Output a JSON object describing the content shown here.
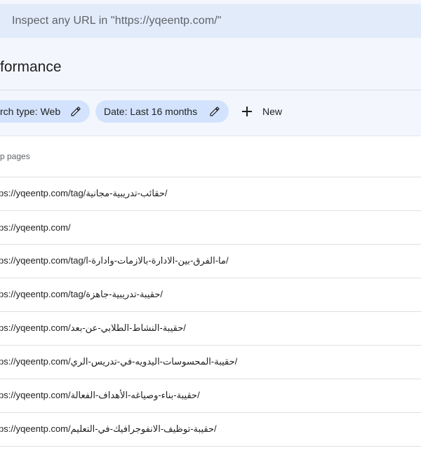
{
  "search": {
    "placeholder": "Inspect any URL in \"https://yqeentp.com/\""
  },
  "page": {
    "title": "formance"
  },
  "filters": {
    "chips": [
      {
        "label": "rch type: Web",
        "icon": "pencil-icon"
      },
      {
        "label": "Date: Last 16 months",
        "icon": "pencil-icon"
      }
    ],
    "new_label": "New"
  },
  "table": {
    "header": "p pages",
    "rows": [
      "ps://yqeentp.com/tag/حقائب-تدريبية-مجانية/",
      "ps://yqeentp.com/",
      "ps://yqeentp.com/tag/ما-الفرق-بين-الادارة-بالازمات-وادارة-ا/",
      "ps://yqeentp.com/tag/حقيبة-تدريبية-جاهزة/",
      "ps://yqeentp.com/حقيبة-النشاط-الطلابي-عن-بعد/",
      "ps://yqeentp.com/حقيبة-المحسوسات-اليدويه-في-تدريس-الري/",
      "ps://yqeentp.com/حقيبة-بناء-وصياغه-الأهداف-الفعالة/",
      "ps://yqeentp.com/حقيبة-توظيف-الانفوجرافيك-في-التعليم/"
    ]
  },
  "colors": {
    "top_band": "#f3f6fc",
    "search_bg": "#e2ebfa",
    "chip_bg": "#d3e3fd",
    "divider": "#e0e0e0"
  }
}
